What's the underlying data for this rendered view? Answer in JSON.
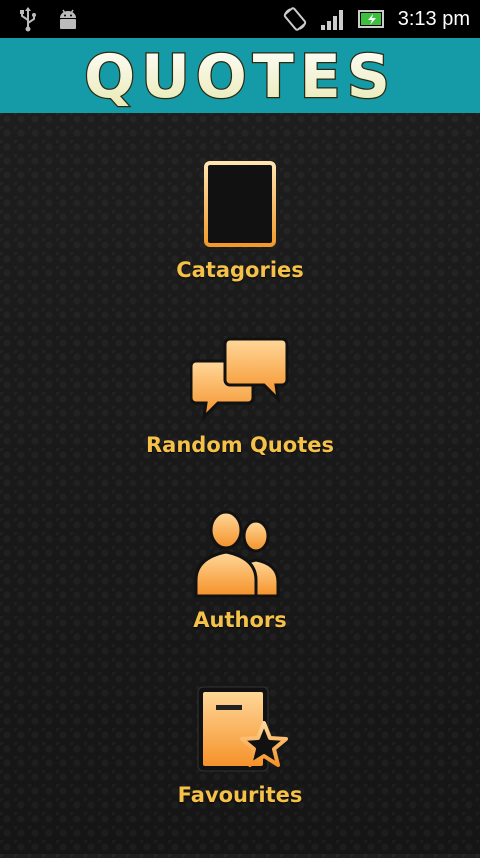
{
  "status_bar": {
    "time": "3:13 pm",
    "icons": [
      "usb-icon",
      "android-debug-icon",
      "screen-rotate-icon",
      "signal-icon",
      "battery-charging-icon"
    ]
  },
  "header": {
    "title": "QUOTES"
  },
  "menu": {
    "items": [
      {
        "label": "Catagories",
        "icon": "list-document-icon"
      },
      {
        "label": "Random Quotes",
        "icon": "speech-bubbles-icon"
      },
      {
        "label": "Authors",
        "icon": "people-icon"
      },
      {
        "label": "Favourites",
        "icon": "favourite-star-icon"
      }
    ]
  },
  "colors": {
    "accent": "#159aa8",
    "label": "#f5c148",
    "logo_fill": "#fbfbd8",
    "icon_orange": "#f6a33e"
  }
}
